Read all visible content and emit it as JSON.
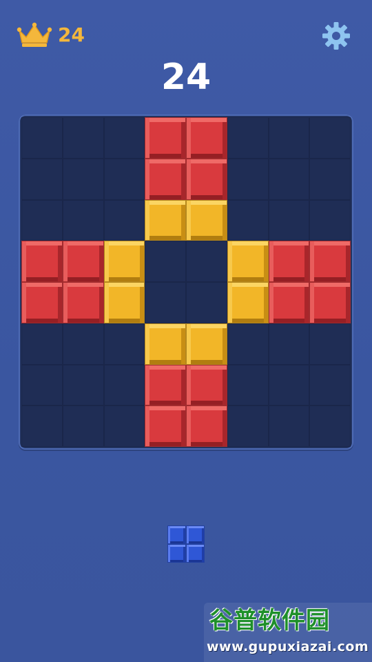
{
  "header": {
    "best_score": "24",
    "best_icon": "crown-icon",
    "settings_icon": "gear-icon"
  },
  "score": "24",
  "board": {
    "rows": 8,
    "cols": 8,
    "cells": [
      [
        "empty",
        "empty",
        "empty",
        "red",
        "red",
        "empty",
        "empty",
        "empty"
      ],
      [
        "empty",
        "empty",
        "empty",
        "red",
        "red",
        "empty",
        "empty",
        "empty"
      ],
      [
        "empty",
        "empty",
        "empty",
        "yellow",
        "yellow",
        "empty",
        "empty",
        "empty"
      ],
      [
        "red",
        "red",
        "yellow",
        "empty",
        "empty",
        "yellow",
        "red",
        "red"
      ],
      [
        "red",
        "red",
        "yellow",
        "empty",
        "empty",
        "yellow",
        "red",
        "red"
      ],
      [
        "empty",
        "empty",
        "empty",
        "yellow",
        "yellow",
        "empty",
        "empty",
        "empty"
      ],
      [
        "empty",
        "empty",
        "empty",
        "red",
        "red",
        "empty",
        "empty",
        "empty"
      ],
      [
        "empty",
        "empty",
        "empty",
        "red",
        "red",
        "empty",
        "empty",
        "empty"
      ]
    ]
  },
  "pieces": [
    {
      "color": "blue",
      "shape": [
        [
          1,
          1
        ],
        [
          1,
          1
        ]
      ]
    }
  ],
  "colors": {
    "background": "#3f5aa6",
    "board": "#233460",
    "red": "#d93a3e",
    "yellow": "#f2b628",
    "blue": "#2f57d6",
    "best_text": "#f4b73c",
    "gear": "#8ec4f0"
  },
  "watermark": {
    "title": "谷普软件园",
    "url": "www.gupuxiazai.com"
  }
}
